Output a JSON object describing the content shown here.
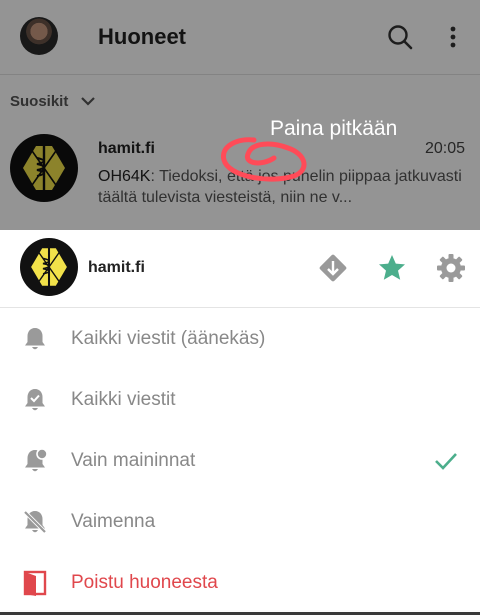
{
  "header": {
    "title": "Huoneet"
  },
  "section": {
    "favourites_label": "Suosikit"
  },
  "room": {
    "name": "hamit.fi",
    "time": "20:05",
    "preview_sender": "OH64K",
    "preview_text": ": Tiedoksi, että jos puhelin piippaa jatkuvasti täältä tulevista viesteistä, niin ne v..."
  },
  "annotation": {
    "text": "Paina pitkään"
  },
  "sheet": {
    "room_name": "hamit.fi",
    "options": [
      {
        "label": "Kaikki viestit (äänekäs)"
      },
      {
        "label": "Kaikki viestit"
      },
      {
        "label": "Vain maininnat"
      },
      {
        "label": "Vaimenna"
      },
      {
        "label": "Poistu huoneesta"
      }
    ]
  },
  "colors": {
    "accent": "#4cae8c",
    "danger": "#e0474c",
    "icon_grey": "#9a9a9a"
  },
  "icons": [
    "search-icon",
    "more-icon",
    "chevron-down-icon",
    "low-priority-icon",
    "favourite-star-icon",
    "settings-gear-icon",
    "bell-icon",
    "bell-check-icon",
    "bell-dot-icon",
    "bell-off-icon",
    "leave-room-icon",
    "check-icon"
  ]
}
